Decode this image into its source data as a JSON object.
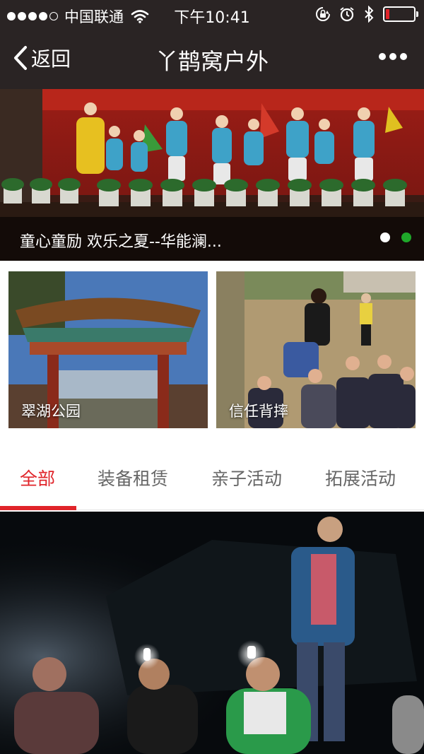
{
  "status_bar": {
    "carrier": "中国联通",
    "time": "下午10:41",
    "battery_level": 0.12
  },
  "nav": {
    "back_label": "返回",
    "title": "丫鹊窝户外"
  },
  "banner": {
    "caption": "童心童励 欢乐之夏--华能澜...",
    "slides": 2,
    "active_slide": 2
  },
  "tiles": [
    {
      "label": "翠湖公园"
    },
    {
      "label": "信任背摔"
    }
  ],
  "tabs": [
    {
      "label": "全部",
      "active": true
    },
    {
      "label": "装备租赁",
      "active": false
    },
    {
      "label": "亲子活动",
      "active": false
    },
    {
      "label": "拓展活动",
      "active": false
    }
  ],
  "colors": {
    "accent": "#e0242a",
    "header_bg": "#2a2424",
    "pager_active": "#1fa82a"
  }
}
